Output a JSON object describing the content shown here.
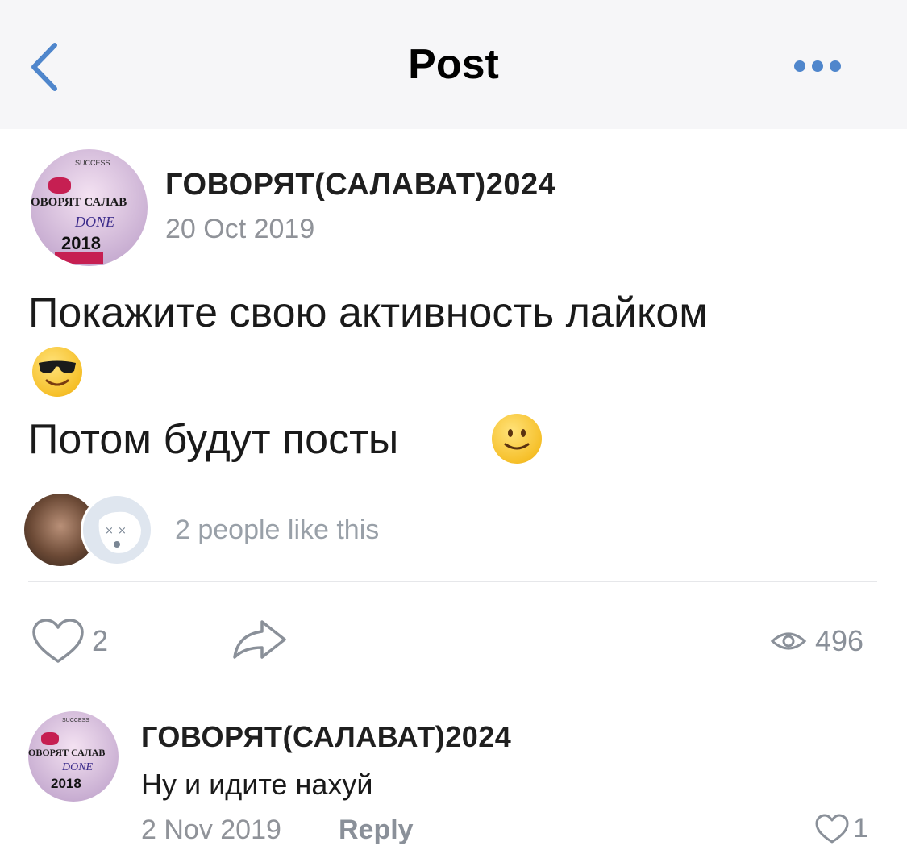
{
  "header": {
    "title": "Post"
  },
  "post": {
    "author": "ГОВОРЯТ(САЛАВАТ)2024",
    "date": "20 Oct 2019",
    "text_line1": "Покажите свою активность лайком",
    "text_line2": "Потом будут посты",
    "avatar_lines": [
      "SUCCESS",
      "ОВОРЯТ САЛАВ",
      "DONE",
      "2018"
    ],
    "likers_text": "2 people like this",
    "like_count": "2",
    "views": "496"
  },
  "comment": {
    "author": "ГОВОРЯТ(САЛАВАТ)2024",
    "text": "Ну и идите нахуй",
    "date": "2 Nov 2019",
    "reply_label": "Reply",
    "like_count": "1"
  },
  "colors": {
    "accent": "#4f86cc",
    "muted": "#909399",
    "header_bg": "#f6f6f8"
  }
}
